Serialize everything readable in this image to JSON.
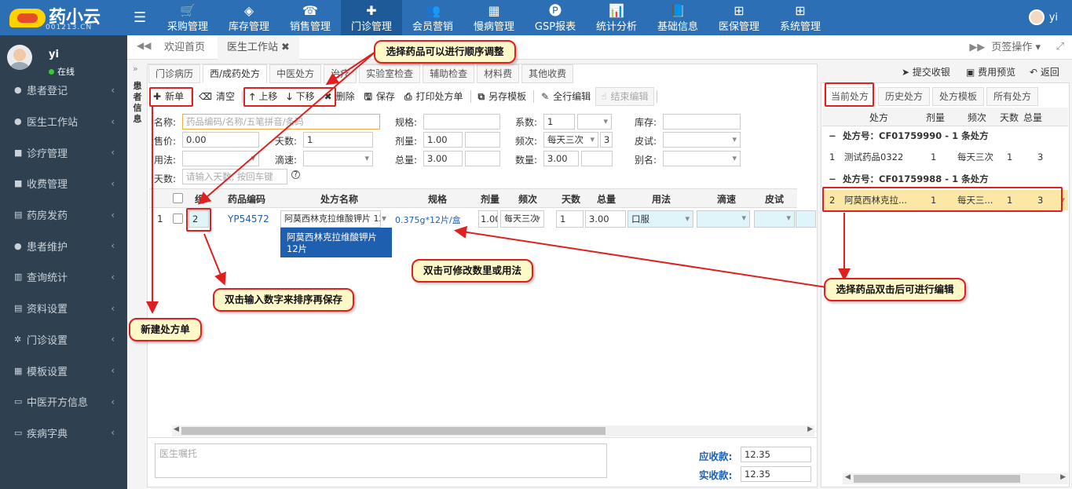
{
  "logo": {
    "title": "药小云",
    "sub": "001213.CN"
  },
  "nav": [
    {
      "label": "采购管理",
      "icon": "cart-icon",
      "glyph": "🛒"
    },
    {
      "label": "库存管理",
      "icon": "cube-icon",
      "glyph": "◈"
    },
    {
      "label": "销售管理",
      "icon": "register-icon",
      "glyph": "☎"
    },
    {
      "label": "门诊管理",
      "icon": "medkit-icon",
      "glyph": "✚"
    },
    {
      "label": "会员营销",
      "icon": "users-icon",
      "glyph": "👥"
    },
    {
      "label": "慢病管理",
      "icon": "building-icon",
      "glyph": "▦"
    },
    {
      "label": "GSP报表",
      "icon": "report-icon",
      "glyph": "🅟"
    },
    {
      "label": "统计分析",
      "icon": "barchart-icon",
      "glyph": "📊"
    },
    {
      "label": "基础信息",
      "icon": "book-icon",
      "glyph": "📘"
    },
    {
      "label": "医保管理",
      "icon": "windows-icon",
      "glyph": "⊞"
    },
    {
      "label": "系统管理",
      "icon": "windows-icon",
      "glyph": "⊞"
    }
  ],
  "user": {
    "name": "yi",
    "status": "在线"
  },
  "sidebar": [
    {
      "label": "患者登记",
      "glyph": "●"
    },
    {
      "label": "医生工作站",
      "glyph": "●"
    },
    {
      "label": "诊疗管理",
      "glyph": "■"
    },
    {
      "label": "收费管理",
      "glyph": "■"
    },
    {
      "label": "药房发药",
      "glyph": "▤"
    },
    {
      "label": "患者维护",
      "glyph": "●"
    },
    {
      "label": "查询统计",
      "glyph": "▥"
    },
    {
      "label": "资料设置",
      "glyph": "▤"
    },
    {
      "label": "门诊设置",
      "glyph": "✲"
    },
    {
      "label": "模板设置",
      "glyph": "▦"
    },
    {
      "label": "中医开方信息",
      "glyph": "▭"
    },
    {
      "label": "疾病字典",
      "glyph": "▭"
    }
  ],
  "page_tabs": {
    "home": "欢迎首页",
    "current": "医生工作站",
    "page_op": "页签操作"
  },
  "patient_strip": "患者信息",
  "sub_tabs": [
    "门诊病历",
    "西/成药处方",
    "中医处方",
    "治疗",
    "实验室检查",
    "辅助检查",
    "材料费",
    "其他收费"
  ],
  "toolbar": {
    "new": "新单",
    "clear": "清空",
    "up": "上移",
    "down": "下移",
    "delete": "删除",
    "save": "保存",
    "print": "打印处方单",
    "save_tpl": "另存模板",
    "edit_all": "全行编辑",
    "end_edit": "结束编辑"
  },
  "right_toolbar": {
    "submit": "提交收银",
    "preview": "费用预览",
    "back": "返回"
  },
  "form": {
    "name_label": "名称:",
    "name_ph": "药品编码/名称/五笔拼音/条码",
    "spec_label": "规格:",
    "coef_label": "系数:",
    "coef_val": "1",
    "stock_label": "库存:",
    "price_label": "售价:",
    "price_val": "0.00",
    "days_label": "天数:",
    "days_val": "1",
    "dose_label": "剂量:",
    "dose_val": "1.00",
    "freq_label": "频次:",
    "freq_val": "每天三次",
    "freq_num": "3",
    "skin_label": "皮试:",
    "usage_label": "用法:",
    "drip_label": "滴速:",
    "total_label": "总量:",
    "total_val": "3.00",
    "qty_label": "数量:",
    "qty_val": "3.00",
    "alias_label": "别名:",
    "days2_label": "天数:",
    "days2_ph": "请输入天数, 按回车键",
    "help": "?"
  },
  "grid": {
    "headers": [
      "组",
      "药品编码",
      "处方名称",
      "规格",
      "剂量",
      "频次",
      "天数",
      "总量",
      "用法",
      "滴速",
      "皮试"
    ],
    "row": {
      "no": "1",
      "group": "2",
      "code": "YP54572",
      "name": "阿莫西林克拉维酸钾片 12",
      "spec": "0.375g*12片/盒",
      "dose": "1.00",
      "freq": "每天三次",
      "days": "1",
      "total": "3.00",
      "usage": "口服"
    },
    "dropdown": "阿莫西林克拉维酸钾片 12片"
  },
  "remark_ph": "医生嘱托",
  "money": {
    "due_label": "应收款:",
    "due_val": "12.35",
    "paid_label": "实收款:",
    "paid_val": "12.35"
  },
  "right": {
    "tabs": [
      "当前处方",
      "历史处方",
      "处方模板",
      "所有处方"
    ],
    "headers": [
      "处方",
      "剂量",
      "频次",
      "天数",
      "总量"
    ],
    "groups": [
      {
        "title": "处方号：CF01759990 - 1 条处方",
        "rows": [
          {
            "no": "1",
            "name": "测试药品0322",
            "dose": "1",
            "freq": "每天三次",
            "days": "1",
            "total": "3"
          }
        ]
      },
      {
        "title": "处方号：CF01759988 - 1 条处方",
        "rows": [
          {
            "no": "2",
            "name": "阿莫西林克拉...",
            "dose": "1",
            "freq": "每天三...",
            "days": "1",
            "total": "3"
          }
        ]
      }
    ]
  },
  "callouts": {
    "reorder": "选择药品可以进行顺序调整",
    "modify": "双击可修改数里或用法",
    "sort": "双击输入数字来排序再保存",
    "newrx": "新建处方单",
    "edit": "选择药品双击后可进行编辑"
  },
  "colors": {
    "topbar": "#2c6fb5",
    "sidebar": "#2f4050",
    "highlight": "#e02020",
    "callout": "#fff8c8",
    "selected_row": "#fbe8a6"
  }
}
